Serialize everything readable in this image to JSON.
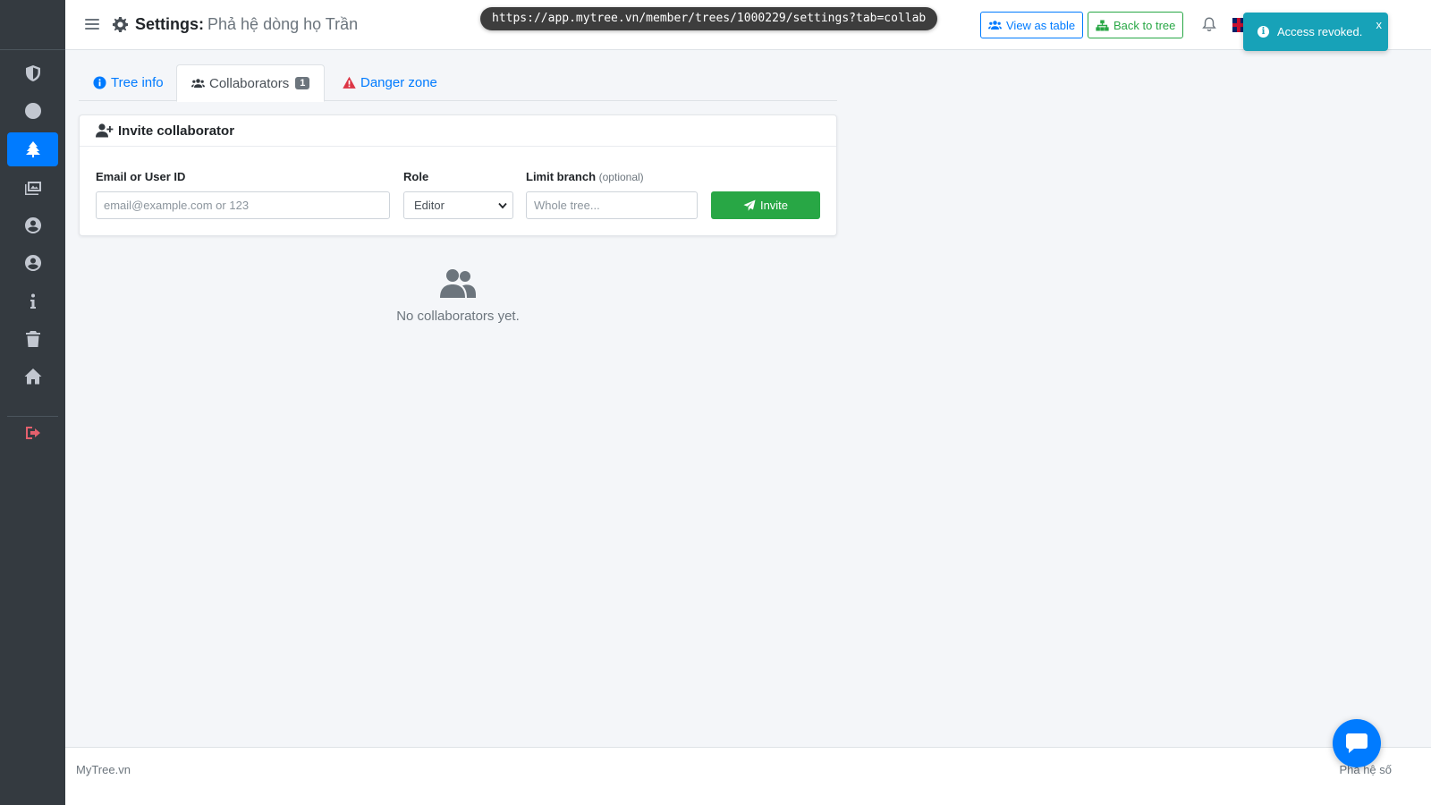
{
  "header": {
    "page_label": "Settings:",
    "tree_name": "Phả hệ dòng họ Trần",
    "url": "https://app.mytree.vn/member/trees/1000229/settings?tab=collab",
    "view_table_label": "View as table",
    "back_tree_label": "Back to tree"
  },
  "toast": {
    "message": "Access revoked.",
    "close": "x"
  },
  "tabs": {
    "tree_info": "Tree info",
    "collaborators": "Collaborators",
    "collaborators_count": "1",
    "danger_zone": "Danger zone"
  },
  "invite": {
    "title": "Invite collaborator",
    "email_label": "Email or User ID",
    "email_placeholder": "email@example.com or 123",
    "role_label": "Role",
    "role_value": "Editor",
    "branch_label": "Limit branch",
    "branch_optional": "(optional)",
    "branch_placeholder": "Whole tree...",
    "invite_button": "Invite"
  },
  "empty_state": {
    "message": "No collaborators yet."
  },
  "footer": {
    "left": "MyTree.vn",
    "right": "Phả hệ số"
  },
  "colors": {
    "primary": "#007bff",
    "success": "#28a745",
    "info": "#17a2b8",
    "danger": "#dc3545",
    "sidebar": "#343a40"
  },
  "icons": {
    "sidebar": [
      "shield-icon",
      "circle-icon",
      "tree-icon",
      "images-icon",
      "user-circle-icon",
      "user-circle-icon",
      "info-icon",
      "trash-icon",
      "home-icon",
      "logout-icon"
    ]
  }
}
